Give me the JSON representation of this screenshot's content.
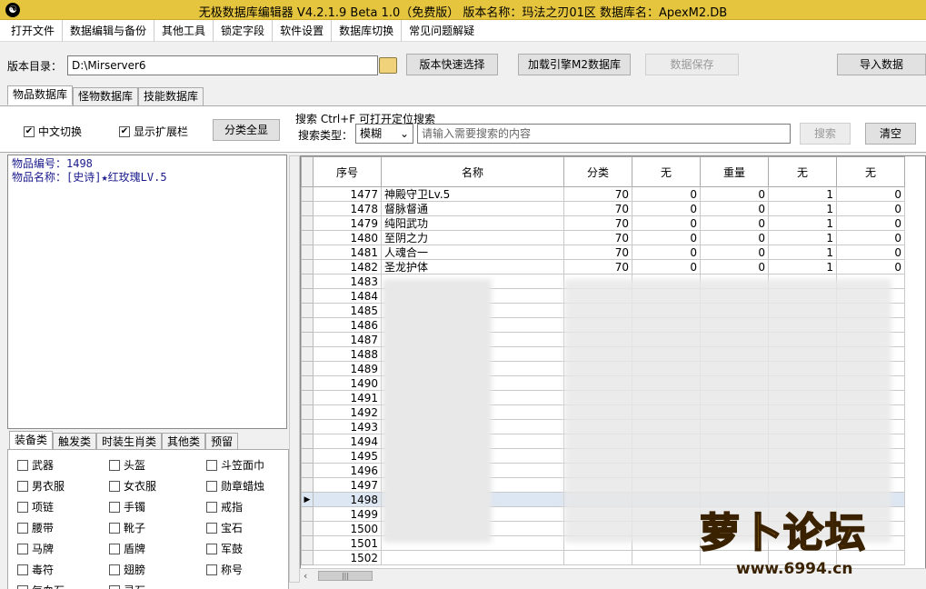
{
  "window": {
    "title": "无极数据库编辑器 V4.2.1.9  Beta 1.0（免费版）  版本名称：玛法之刃01区    数据库名：ApexM2.DB",
    "icon": "yin-yang-icon"
  },
  "menu": [
    "打开文件",
    "数据编辑与备份",
    "其他工具",
    "锁定字段",
    "软件设置",
    "数据库切换",
    "常见问题解疑"
  ],
  "path_row": {
    "label": "版本目录：",
    "value": "D:\\Mirserver6",
    "folder_icon": "folder-icon",
    "quick_select": "版本快速选择",
    "load_engine": "加载引擎M2数据库",
    "save": "数据保存",
    "import": "导入数据"
  },
  "db_tabs": [
    "物品数据库",
    "怪物数据库",
    "技能数据库"
  ],
  "options": {
    "chinese_toggle": "中文切换",
    "chinese_checked": true,
    "show_ext": "显示扩展栏",
    "show_ext_checked": true,
    "show_all": "分类全显"
  },
  "search": {
    "header": "搜索   Ctrl+F 可打开定位搜索",
    "type_label": "搜索类型：",
    "type_value": "模糊",
    "placeholder": "请输入需要搜索的内容",
    "search_btn": "搜索",
    "clear_btn": "清空"
  },
  "item_info": {
    "line1": "物品编号：1498",
    "line2": "物品名称：[史诗]★红玫瑰LV.5"
  },
  "category_tabs": [
    "装备类",
    "触发类",
    "时装生肖类",
    "其他类",
    "预留"
  ],
  "categories": [
    [
      "武器",
      "头盔",
      "斗笠面巾"
    ],
    [
      "男衣服",
      "女衣服",
      "勋章蜡烛"
    ],
    [
      "项链",
      "手镯",
      "戒指"
    ],
    [
      "腰带",
      "靴子",
      "宝石"
    ],
    [
      "马牌",
      "盾牌",
      "军鼓"
    ],
    [
      "毒符",
      "翅膀",
      "称号"
    ],
    [
      "气血石",
      "灵石",
      ""
    ]
  ],
  "table": {
    "columns": [
      "序号",
      "名称",
      "分类",
      "无",
      "重量",
      "无",
      "无"
    ],
    "rows": [
      [
        "1477",
        "神殿守卫Lv.5",
        "70",
        "0",
        "0",
        "1",
        "0"
      ],
      [
        "1478",
        "督脉督通",
        "70",
        "0",
        "0",
        "1",
        "0"
      ],
      [
        "1479",
        "纯阳武功",
        "70",
        "0",
        "0",
        "1",
        "0"
      ],
      [
        "1480",
        "至阴之力",
        "70",
        "0",
        "0",
        "1",
        "0"
      ],
      [
        "1481",
        "人魂合一",
        "70",
        "0",
        "0",
        "1",
        "0"
      ],
      [
        "1482",
        "圣龙护体",
        "70",
        "0",
        "0",
        "1",
        "0"
      ],
      [
        "1483",
        "",
        "",
        "",
        "",
        "",
        ""
      ],
      [
        "1484",
        "",
        "",
        "",
        "",
        "",
        ""
      ],
      [
        "1485",
        "",
        "",
        "",
        "",
        "",
        ""
      ],
      [
        "1486",
        "",
        "",
        "",
        "",
        "",
        ""
      ],
      [
        "1487",
        "",
        "",
        "",
        "",
        "",
        ""
      ],
      [
        "1488",
        "",
        "",
        "",
        "",
        "",
        ""
      ],
      [
        "1489",
        "",
        "",
        "",
        "",
        "",
        ""
      ],
      [
        "1490",
        "",
        "",
        "",
        "",
        "",
        ""
      ],
      [
        "1491",
        "",
        "",
        "",
        "",
        "",
        ""
      ],
      [
        "1492",
        "",
        "",
        "",
        "",
        "",
        ""
      ],
      [
        "1493",
        "",
        "",
        "",
        "",
        "",
        ""
      ],
      [
        "1494",
        "",
        "",
        "",
        "",
        "",
        ""
      ],
      [
        "1495",
        "",
        "",
        "",
        "",
        "",
        ""
      ],
      [
        "1496",
        "",
        "",
        "",
        "",
        "",
        ""
      ],
      [
        "1497",
        "",
        "",
        "",
        "",
        "",
        ""
      ],
      [
        "1498",
        "",
        "",
        "",
        "",
        "",
        ""
      ],
      [
        "1499",
        "",
        "",
        "",
        "",
        "",
        ""
      ],
      [
        "1500",
        "",
        "",
        "",
        "",
        "",
        ""
      ],
      [
        "1501",
        "",
        "",
        "",
        "",
        "",
        ""
      ],
      [
        "1502",
        "",
        "",
        "",
        "",
        "",
        ""
      ]
    ],
    "selected": "1498"
  },
  "watermark": {
    "text": "萝卜论坛",
    "url": "www.6994.cn"
  }
}
